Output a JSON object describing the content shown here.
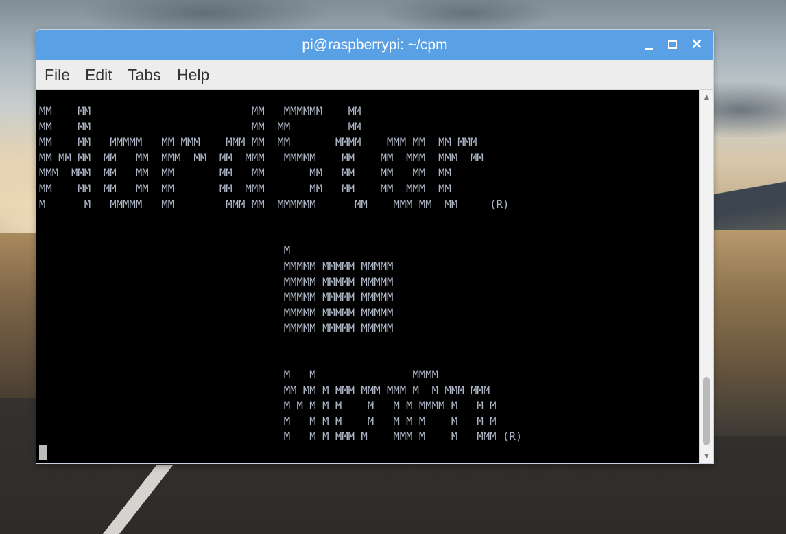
{
  "window": {
    "title": "pi@raspberrypi: ~/cpm",
    "minimize_icon": "minimize-icon",
    "maximize_icon": "maximize-icon",
    "close_icon": "close-icon",
    "close_glyph": "✕"
  },
  "menubar": {
    "items": [
      {
        "label": "File"
      },
      {
        "label": "Edit"
      },
      {
        "label": "Tabs"
      },
      {
        "label": "Help"
      }
    ]
  },
  "terminal": {
    "output": "MM    MM                         MM   MMMMMM    MM\nMM    MM                         MM  MM         MM\nMM    MM   MMMMM   MM MMM    MMM MM  MM       MMMM    MMM MM  MM MMM\nMM MM MM  MM   MM  MMM  MM  MM  MMM   MMMMM    MM    MM  MMM  MMM  MM\nMMM  MMM  MM   MM  MM       MM   MM       MM   MM    MM   MM  MM\nMM    MM  MM   MM  MM       MM  MMM       MM   MM    MM  MMM  MM\nM      M   MMMMM   MM        MMM MM  MMMMMM      MM    MMM MM  MM     (R)\n\n\n                                      M\n                                      MMMMM MMMMM MMMMM\n                                      MMMMM MMMMM MMMMM\n                                      MMMMM MMMMM MMMMM\n                                      MMMMM MMMMM MMMMM\n                                      MMMMM MMMMM MMMMM\n\n\n                                      M   M               MMMM\n                                      MM MM M MMM MMM MMM M  M MMM MMM\n                                      M M M M M    M   M M MMMM M   M M\n                                      M   M M M    M   M M M    M   M M\n                                      M   M M MMM M    MMM M    M   MMM (R)"
  },
  "scrollbar": {
    "up_arrow": "chevron-up-icon",
    "down_arrow": "chevron-down-icon",
    "position": 0.92
  },
  "colors": {
    "titlebar": "#5aa0e4",
    "menubar": "#ededed",
    "terminal_bg": "#000000",
    "terminal_fg": "#aeb6c6"
  }
}
